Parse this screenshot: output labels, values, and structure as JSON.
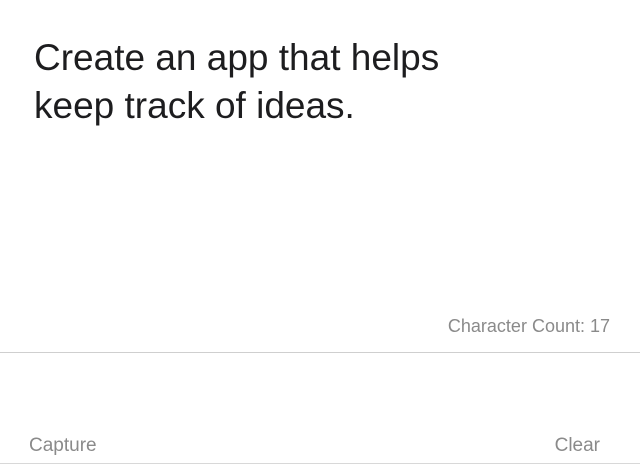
{
  "note": {
    "text": "Create an app that helps\nkeep track of ideas."
  },
  "status": {
    "character_count": "Character Count: 17"
  },
  "toolbar": {
    "capture_label": "Capture",
    "clear_label": "Clear"
  }
}
